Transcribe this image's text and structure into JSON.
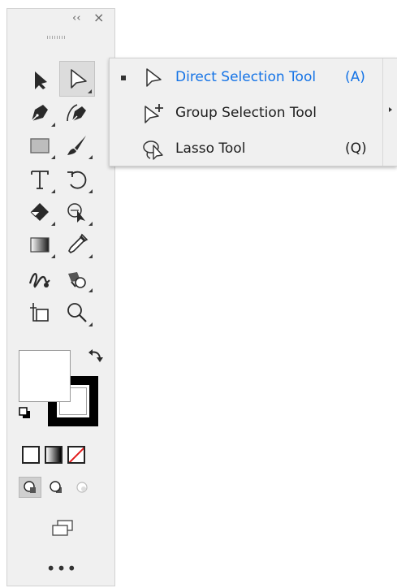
{
  "panel": {
    "collapse_glyph": "‹‹",
    "close_glyph": "×",
    "tools": [
      {
        "name": "selection-tool",
        "icon": "black-arrow-icon",
        "active": false
      },
      {
        "name": "direct-selection-tool",
        "icon": "white-arrow-icon",
        "active": true
      },
      {
        "name": "pen-tool",
        "icon": "pen-icon",
        "active": false
      },
      {
        "name": "curvature-tool",
        "icon": "curvature-pen-icon",
        "active": false
      },
      {
        "name": "rectangle-tool",
        "icon": "rectangle-icon",
        "active": false
      },
      {
        "name": "paintbrush-tool",
        "icon": "brush-icon",
        "active": false
      },
      {
        "name": "type-tool",
        "icon": "type-t-icon",
        "active": false
      },
      {
        "name": "rotate-tool",
        "icon": "rotate-icon",
        "active": false
      },
      {
        "name": "eraser-tool",
        "icon": "eraser-icon",
        "active": false
      },
      {
        "name": "shape-builder-tool",
        "icon": "shape-builder-icon",
        "active": false
      },
      {
        "name": "gradient-tool",
        "icon": "gradient-icon",
        "active": false
      },
      {
        "name": "eyedropper-tool",
        "icon": "eyedropper-icon",
        "active": false
      },
      {
        "name": "blend-tool",
        "icon": "blend-icon",
        "active": false
      },
      {
        "name": "live-paint-bucket-tool",
        "icon": "live-paint-icon",
        "active": false
      },
      {
        "name": "artboard-tool",
        "icon": "artboard-icon",
        "active": false
      },
      {
        "name": "zoom-tool",
        "icon": "magnifier-icon",
        "active": false
      }
    ],
    "fill_color": "#ffffff",
    "stroke_color": "#000000",
    "more_label": "•••"
  },
  "flyout": {
    "items": [
      {
        "label": "Direct Selection Tool",
        "shortcut": "(A)",
        "icon": "direct-selection-icon",
        "selected": true
      },
      {
        "label": "Group Selection Tool",
        "shortcut": "",
        "icon": "group-selection-icon",
        "selected": false
      },
      {
        "label": "Lasso Tool",
        "shortcut": "(Q)",
        "icon": "lasso-icon",
        "selected": false
      }
    ],
    "selected_color": "#1473e6",
    "text_color": "#1d1d1d"
  }
}
